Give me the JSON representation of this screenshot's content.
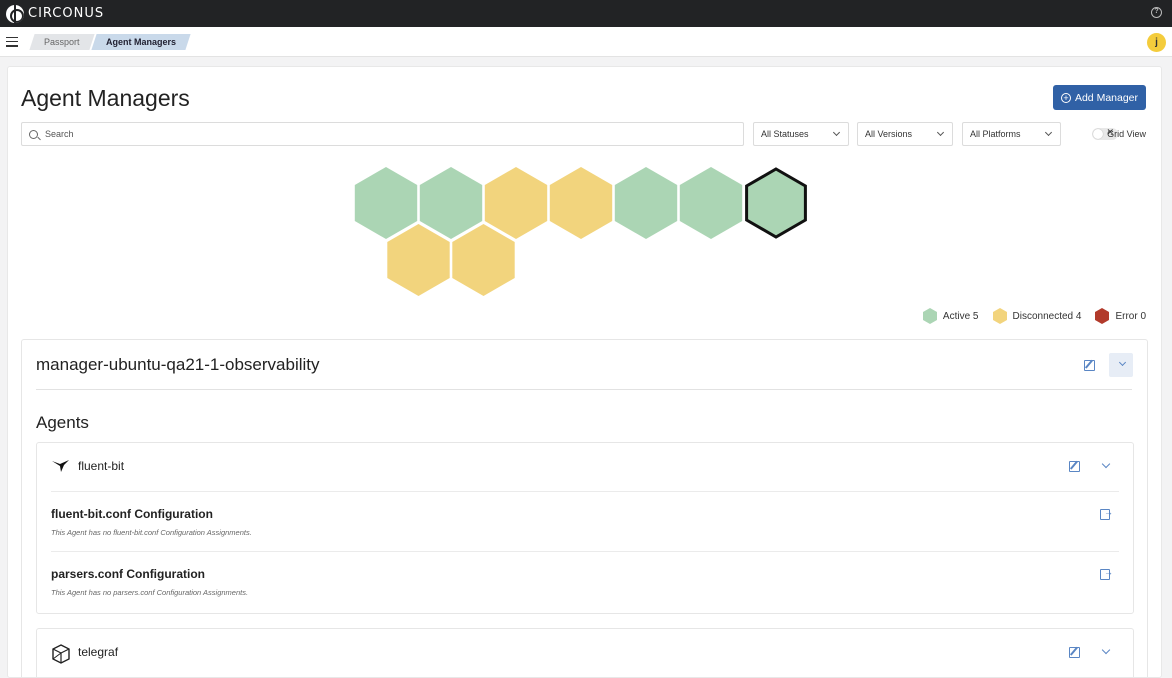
{
  "app": {
    "brand": "CIRCONUS",
    "help_label": "?",
    "user_initial": "j"
  },
  "breadcrumb": [
    "Passport",
    "Agent Managers"
  ],
  "page": {
    "title": "Agent Managers",
    "add_button": "Add Manager",
    "search_placeholder": "Search",
    "filters": {
      "status": "All Statuses",
      "version": "All Versions",
      "platform": "All Platforms"
    },
    "grid_view_label": "Grid View",
    "grid_view_enabled": false
  },
  "hex_tiles": [
    {
      "status": "active",
      "selected": false
    },
    {
      "status": "active",
      "selected": false
    },
    {
      "status": "disconnected",
      "selected": false
    },
    {
      "status": "disconnected",
      "selected": false
    },
    {
      "status": "active",
      "selected": false
    },
    {
      "status": "active",
      "selected": false
    },
    {
      "status": "active",
      "selected": true
    },
    {
      "status": "disconnected",
      "selected": false
    },
    {
      "status": "disconnected",
      "selected": false
    }
  ],
  "status_colors": {
    "active": "#abd5b4",
    "disconnected": "#f2d47d",
    "error": "#b23a2b",
    "accent": "#3061a6"
  },
  "legend": [
    {
      "key": "active",
      "label": "Active 5"
    },
    {
      "key": "disconnected",
      "label": "Disconnected 4"
    },
    {
      "key": "error",
      "label": "Error 0"
    }
  ],
  "manager": {
    "name": "manager-ubuntu-qa21-1-observability",
    "agents_heading": "Agents",
    "agents": [
      {
        "name": "fluent-bit",
        "icon": "fluent-bit-bird-icon",
        "configs": [
          {
            "title": "fluent-bit.conf Configuration",
            "note": "This Agent has no fluent-bit.conf Configuration Assignments."
          },
          {
            "title": "parsers.conf Configuration",
            "note": "This Agent has no parsers.conf Configuration Assignments."
          }
        ]
      },
      {
        "name": "telegraf",
        "icon": "telegraf-icon",
        "configs": []
      }
    ]
  }
}
